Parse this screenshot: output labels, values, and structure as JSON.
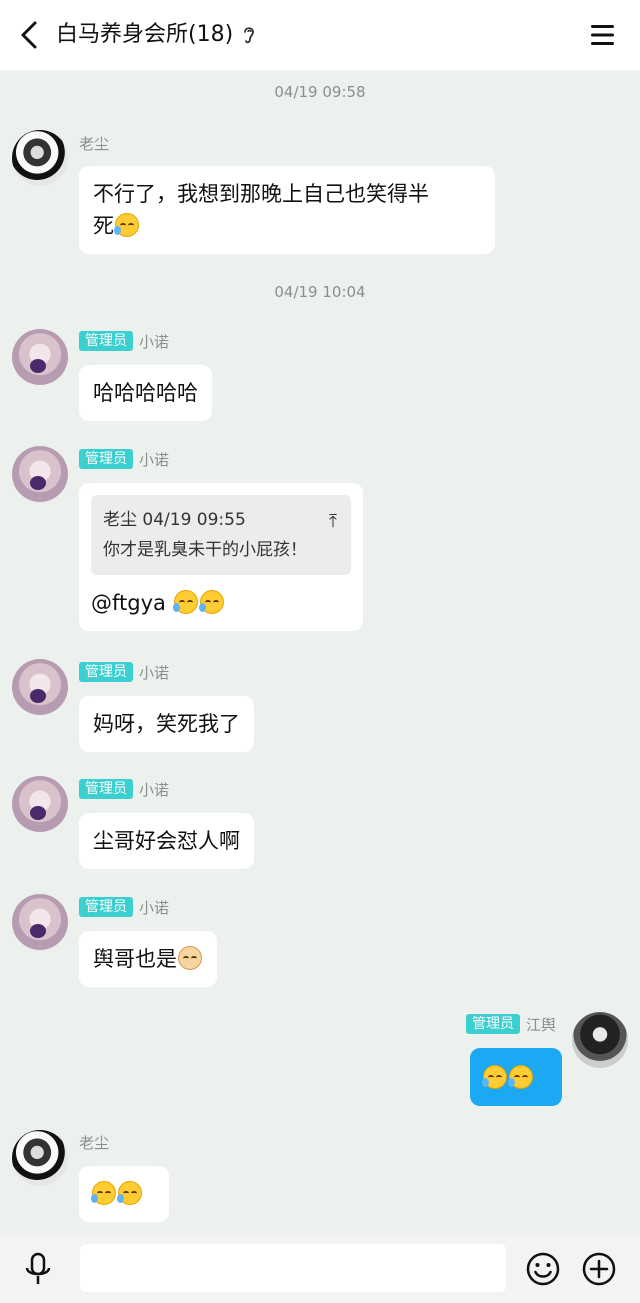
{
  "header": {
    "title": "白马养身会所(18)"
  },
  "timestamps": [
    "04/19 09:58",
    "04/19 10:04"
  ],
  "admin_label": "管理员",
  "messages": [
    {
      "sender": "老尘",
      "text": "不行了，我想到那晚上自己也笑得半",
      "text2": "死"
    },
    {
      "sender": "小诺",
      "text": "哈哈哈哈哈"
    },
    {
      "sender": "小诺",
      "quote_header": "老尘 04/19 09:55",
      "quote_text": "你才是乳臭未干的小屁孩！",
      "text": "@ftgya "
    },
    {
      "sender": "小诺",
      "text": "妈呀，笑死我了"
    },
    {
      "sender": "小诺",
      "text": "尘哥好会怼人啊"
    },
    {
      "sender": "小诺",
      "text": "舆哥也是"
    },
    {
      "sender": "江舆",
      "text": ""
    },
    {
      "sender": "老尘",
      "text": ""
    }
  ],
  "icons": {
    "back": "chevron-left-icon",
    "menu": "hamburger-menu-icon",
    "ear": "ear-icon",
    "mic": "microphone-icon",
    "emoji": "smiley-icon",
    "plus": "plus-circle-icon"
  },
  "colors": {
    "background": "#edf1ee",
    "admin_badge": "#3ccfd0",
    "self_bubble": "#1aa9f2"
  }
}
